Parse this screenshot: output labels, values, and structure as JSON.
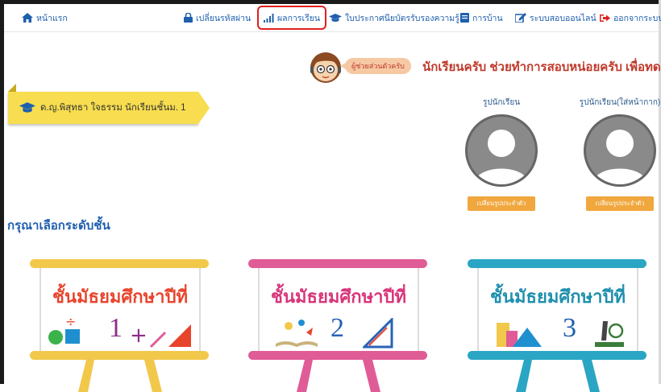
{
  "navbar": {
    "items": [
      {
        "label": "หน้าแรก",
        "icon": "home-icon"
      },
      {
        "label": "เปลี่ยนรหัสผ่าน",
        "icon": "lock-icon"
      },
      {
        "label": "ผลการเรียน",
        "icon": "bar-chart-icon",
        "active": true
      },
      {
        "label": "ใบประกาศนียบัตรรับรองความรู้",
        "icon": "graduation-cap-icon"
      },
      {
        "label": "การบ้าน",
        "icon": "book-icon"
      },
      {
        "label": "ระบบสอบออนไลน์",
        "icon": "edit-icon"
      },
      {
        "label": "ออกจากระบบ",
        "icon": "sign-out-icon"
      }
    ]
  },
  "assistant": {
    "bubble": "ผู้ช่วยส่วนตัวครับ",
    "message": "นักเรียนครับ ช่วยทำการสอบหน่อยครับ เพื่อทดสอ"
  },
  "student": {
    "name": "ด.ญ.พิสุทธา ใจธรรม นักเรียนชั้นม. 1"
  },
  "photos": [
    {
      "label": "รูปนักเรียน",
      "button": "เปลี่ยนรูปประจำตัว"
    },
    {
      "label": "รูปนักเรียน(ใส่หน้ากาก)",
      "button": "เปลี่ยนรูปประจำตัว"
    }
  ],
  "section_title": "กรุณาเลือกระดับชั้น",
  "grades": [
    {
      "title": "ชั้นมัธยมศึกษาปีที่",
      "number": "1",
      "color": "#f2c84b",
      "title_color": "#e8442c",
      "number_color": "#8e2c8a"
    },
    {
      "title": "ชั้นมัธยมศึกษาปีที่",
      "number": "2",
      "color": "#e05c96",
      "title_color": "#d8357a",
      "number_color": "#2a62b8"
    },
    {
      "title": "ชั้นมัธยมศึกษาปีที่",
      "number": "3",
      "color": "#2aa6c4",
      "title_color": "#1f8fae",
      "number_color": "#1f5fae"
    }
  ],
  "colors": {
    "nav_text": "#1f5fae",
    "active_outline": "#e02020",
    "ribbon": "#f7dd4f",
    "photo_button": "#f0a73e"
  }
}
